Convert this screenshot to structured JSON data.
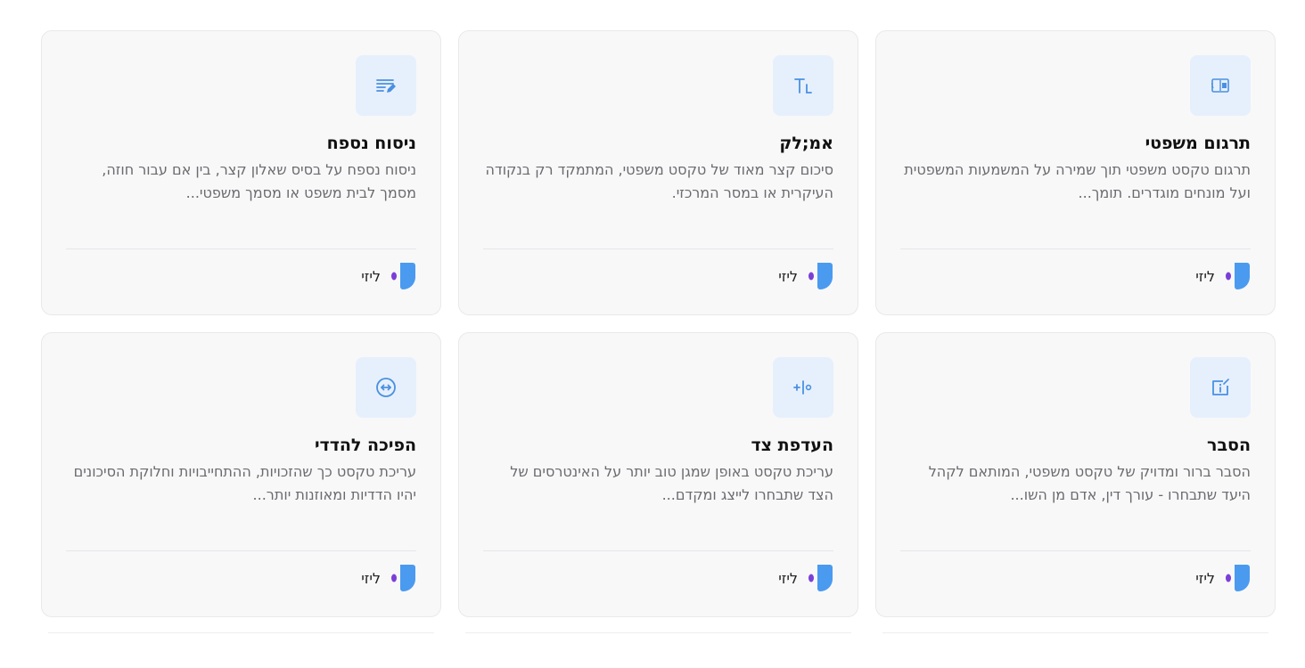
{
  "cards": [
    {
      "icon": "translate-icon",
      "title": "תרגום משפטי",
      "description": "תרגום טקסט משפטי תוך שמירה על המשמעות המשפטית ועל מונחים מוגדרים. תומך...",
      "brand": "ליזי"
    },
    {
      "icon": "text-size-icon",
      "title": "אמ;לק",
      "description": "סיכום קצר מאוד של טקסט משפטי, המתמקד רק בנקודה העיקרית או במסר המרכזי.",
      "brand": "ליזי"
    },
    {
      "icon": "edit-lines-icon",
      "title": "ניסוח נספח",
      "description": "ניסוח נספח על בסיס שאלון קצר, בין אם עבור חוזה, מסמך לבית משפט או מסמך משפטי...",
      "brand": "ליזי"
    },
    {
      "icon": "info-icon",
      "title": "הסבר",
      "description": "הסבר ברור ומדויק של טקסט משפטי, המותאם לקהל היעד שתבחרו - עורך דין, אדם מן השו...",
      "brand": "ליזי"
    },
    {
      "icon": "side-preference-icon",
      "title": "העדפת צד",
      "description": "עריכת טקסט באופן שמגן טוב יותר על האינטרסים של הצד שתבחרו לייצג ומקדם...",
      "brand": "ליזי"
    },
    {
      "icon": "mutual-arrows-icon",
      "title": "הפיכה להדדי",
      "description": "עריכת טקסט כך שהזכויות, ההתחייבויות וחלוקת הסיכונים יהיו הדדיות ומאוזנות יותר...",
      "brand": "ליזי"
    }
  ],
  "colors": {
    "accent": "#4a90e2",
    "icon_tile_bg": "#e6f0fc",
    "logo_blue": "#4a9af0",
    "logo_purple": "#7b3fd6"
  }
}
